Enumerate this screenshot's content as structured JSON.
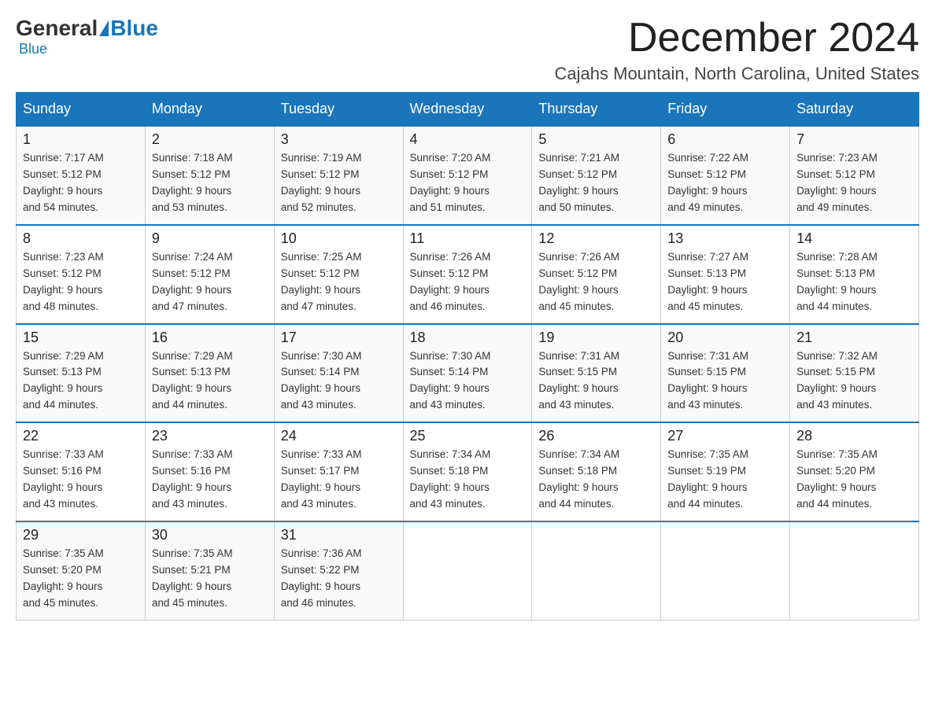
{
  "header": {
    "logo_general": "General",
    "logo_blue": "Blue",
    "month_title": "December 2024",
    "location": "Cajahs Mountain, North Carolina, United States"
  },
  "days_of_week": [
    "Sunday",
    "Monday",
    "Tuesday",
    "Wednesday",
    "Thursday",
    "Friday",
    "Saturday"
  ],
  "weeks": [
    [
      {
        "day": "1",
        "sunrise": "7:17 AM",
        "sunset": "5:12 PM",
        "daylight": "9 hours and 54 minutes."
      },
      {
        "day": "2",
        "sunrise": "7:18 AM",
        "sunset": "5:12 PM",
        "daylight": "9 hours and 53 minutes."
      },
      {
        "day": "3",
        "sunrise": "7:19 AM",
        "sunset": "5:12 PM",
        "daylight": "9 hours and 52 minutes."
      },
      {
        "day": "4",
        "sunrise": "7:20 AM",
        "sunset": "5:12 PM",
        "daylight": "9 hours and 51 minutes."
      },
      {
        "day": "5",
        "sunrise": "7:21 AM",
        "sunset": "5:12 PM",
        "daylight": "9 hours and 50 minutes."
      },
      {
        "day": "6",
        "sunrise": "7:22 AM",
        "sunset": "5:12 PM",
        "daylight": "9 hours and 49 minutes."
      },
      {
        "day": "7",
        "sunrise": "7:23 AM",
        "sunset": "5:12 PM",
        "daylight": "9 hours and 49 minutes."
      }
    ],
    [
      {
        "day": "8",
        "sunrise": "7:23 AM",
        "sunset": "5:12 PM",
        "daylight": "9 hours and 48 minutes."
      },
      {
        "day": "9",
        "sunrise": "7:24 AM",
        "sunset": "5:12 PM",
        "daylight": "9 hours and 47 minutes."
      },
      {
        "day": "10",
        "sunrise": "7:25 AM",
        "sunset": "5:12 PM",
        "daylight": "9 hours and 47 minutes."
      },
      {
        "day": "11",
        "sunrise": "7:26 AM",
        "sunset": "5:12 PM",
        "daylight": "9 hours and 46 minutes."
      },
      {
        "day": "12",
        "sunrise": "7:26 AM",
        "sunset": "5:12 PM",
        "daylight": "9 hours and 45 minutes."
      },
      {
        "day": "13",
        "sunrise": "7:27 AM",
        "sunset": "5:13 PM",
        "daylight": "9 hours and 45 minutes."
      },
      {
        "day": "14",
        "sunrise": "7:28 AM",
        "sunset": "5:13 PM",
        "daylight": "9 hours and 44 minutes."
      }
    ],
    [
      {
        "day": "15",
        "sunrise": "7:29 AM",
        "sunset": "5:13 PM",
        "daylight": "9 hours and 44 minutes."
      },
      {
        "day": "16",
        "sunrise": "7:29 AM",
        "sunset": "5:13 PM",
        "daylight": "9 hours and 44 minutes."
      },
      {
        "day": "17",
        "sunrise": "7:30 AM",
        "sunset": "5:14 PM",
        "daylight": "9 hours and 43 minutes."
      },
      {
        "day": "18",
        "sunrise": "7:30 AM",
        "sunset": "5:14 PM",
        "daylight": "9 hours and 43 minutes."
      },
      {
        "day": "19",
        "sunrise": "7:31 AM",
        "sunset": "5:15 PM",
        "daylight": "9 hours and 43 minutes."
      },
      {
        "day": "20",
        "sunrise": "7:31 AM",
        "sunset": "5:15 PM",
        "daylight": "9 hours and 43 minutes."
      },
      {
        "day": "21",
        "sunrise": "7:32 AM",
        "sunset": "5:15 PM",
        "daylight": "9 hours and 43 minutes."
      }
    ],
    [
      {
        "day": "22",
        "sunrise": "7:33 AM",
        "sunset": "5:16 PM",
        "daylight": "9 hours and 43 minutes."
      },
      {
        "day": "23",
        "sunrise": "7:33 AM",
        "sunset": "5:16 PM",
        "daylight": "9 hours and 43 minutes."
      },
      {
        "day": "24",
        "sunrise": "7:33 AM",
        "sunset": "5:17 PM",
        "daylight": "9 hours and 43 minutes."
      },
      {
        "day": "25",
        "sunrise": "7:34 AM",
        "sunset": "5:18 PM",
        "daylight": "9 hours and 43 minutes."
      },
      {
        "day": "26",
        "sunrise": "7:34 AM",
        "sunset": "5:18 PM",
        "daylight": "9 hours and 44 minutes."
      },
      {
        "day": "27",
        "sunrise": "7:35 AM",
        "sunset": "5:19 PM",
        "daylight": "9 hours and 44 minutes."
      },
      {
        "day": "28",
        "sunrise": "7:35 AM",
        "sunset": "5:20 PM",
        "daylight": "9 hours and 44 minutes."
      }
    ],
    [
      {
        "day": "29",
        "sunrise": "7:35 AM",
        "sunset": "5:20 PM",
        "daylight": "9 hours and 45 minutes."
      },
      {
        "day": "30",
        "sunrise": "7:35 AM",
        "sunset": "5:21 PM",
        "daylight": "9 hours and 45 minutes."
      },
      {
        "day": "31",
        "sunrise": "7:36 AM",
        "sunset": "5:22 PM",
        "daylight": "9 hours and 46 minutes."
      },
      null,
      null,
      null,
      null
    ]
  ],
  "labels": {
    "sunrise": "Sunrise:",
    "sunset": "Sunset:",
    "daylight": "Daylight:"
  }
}
